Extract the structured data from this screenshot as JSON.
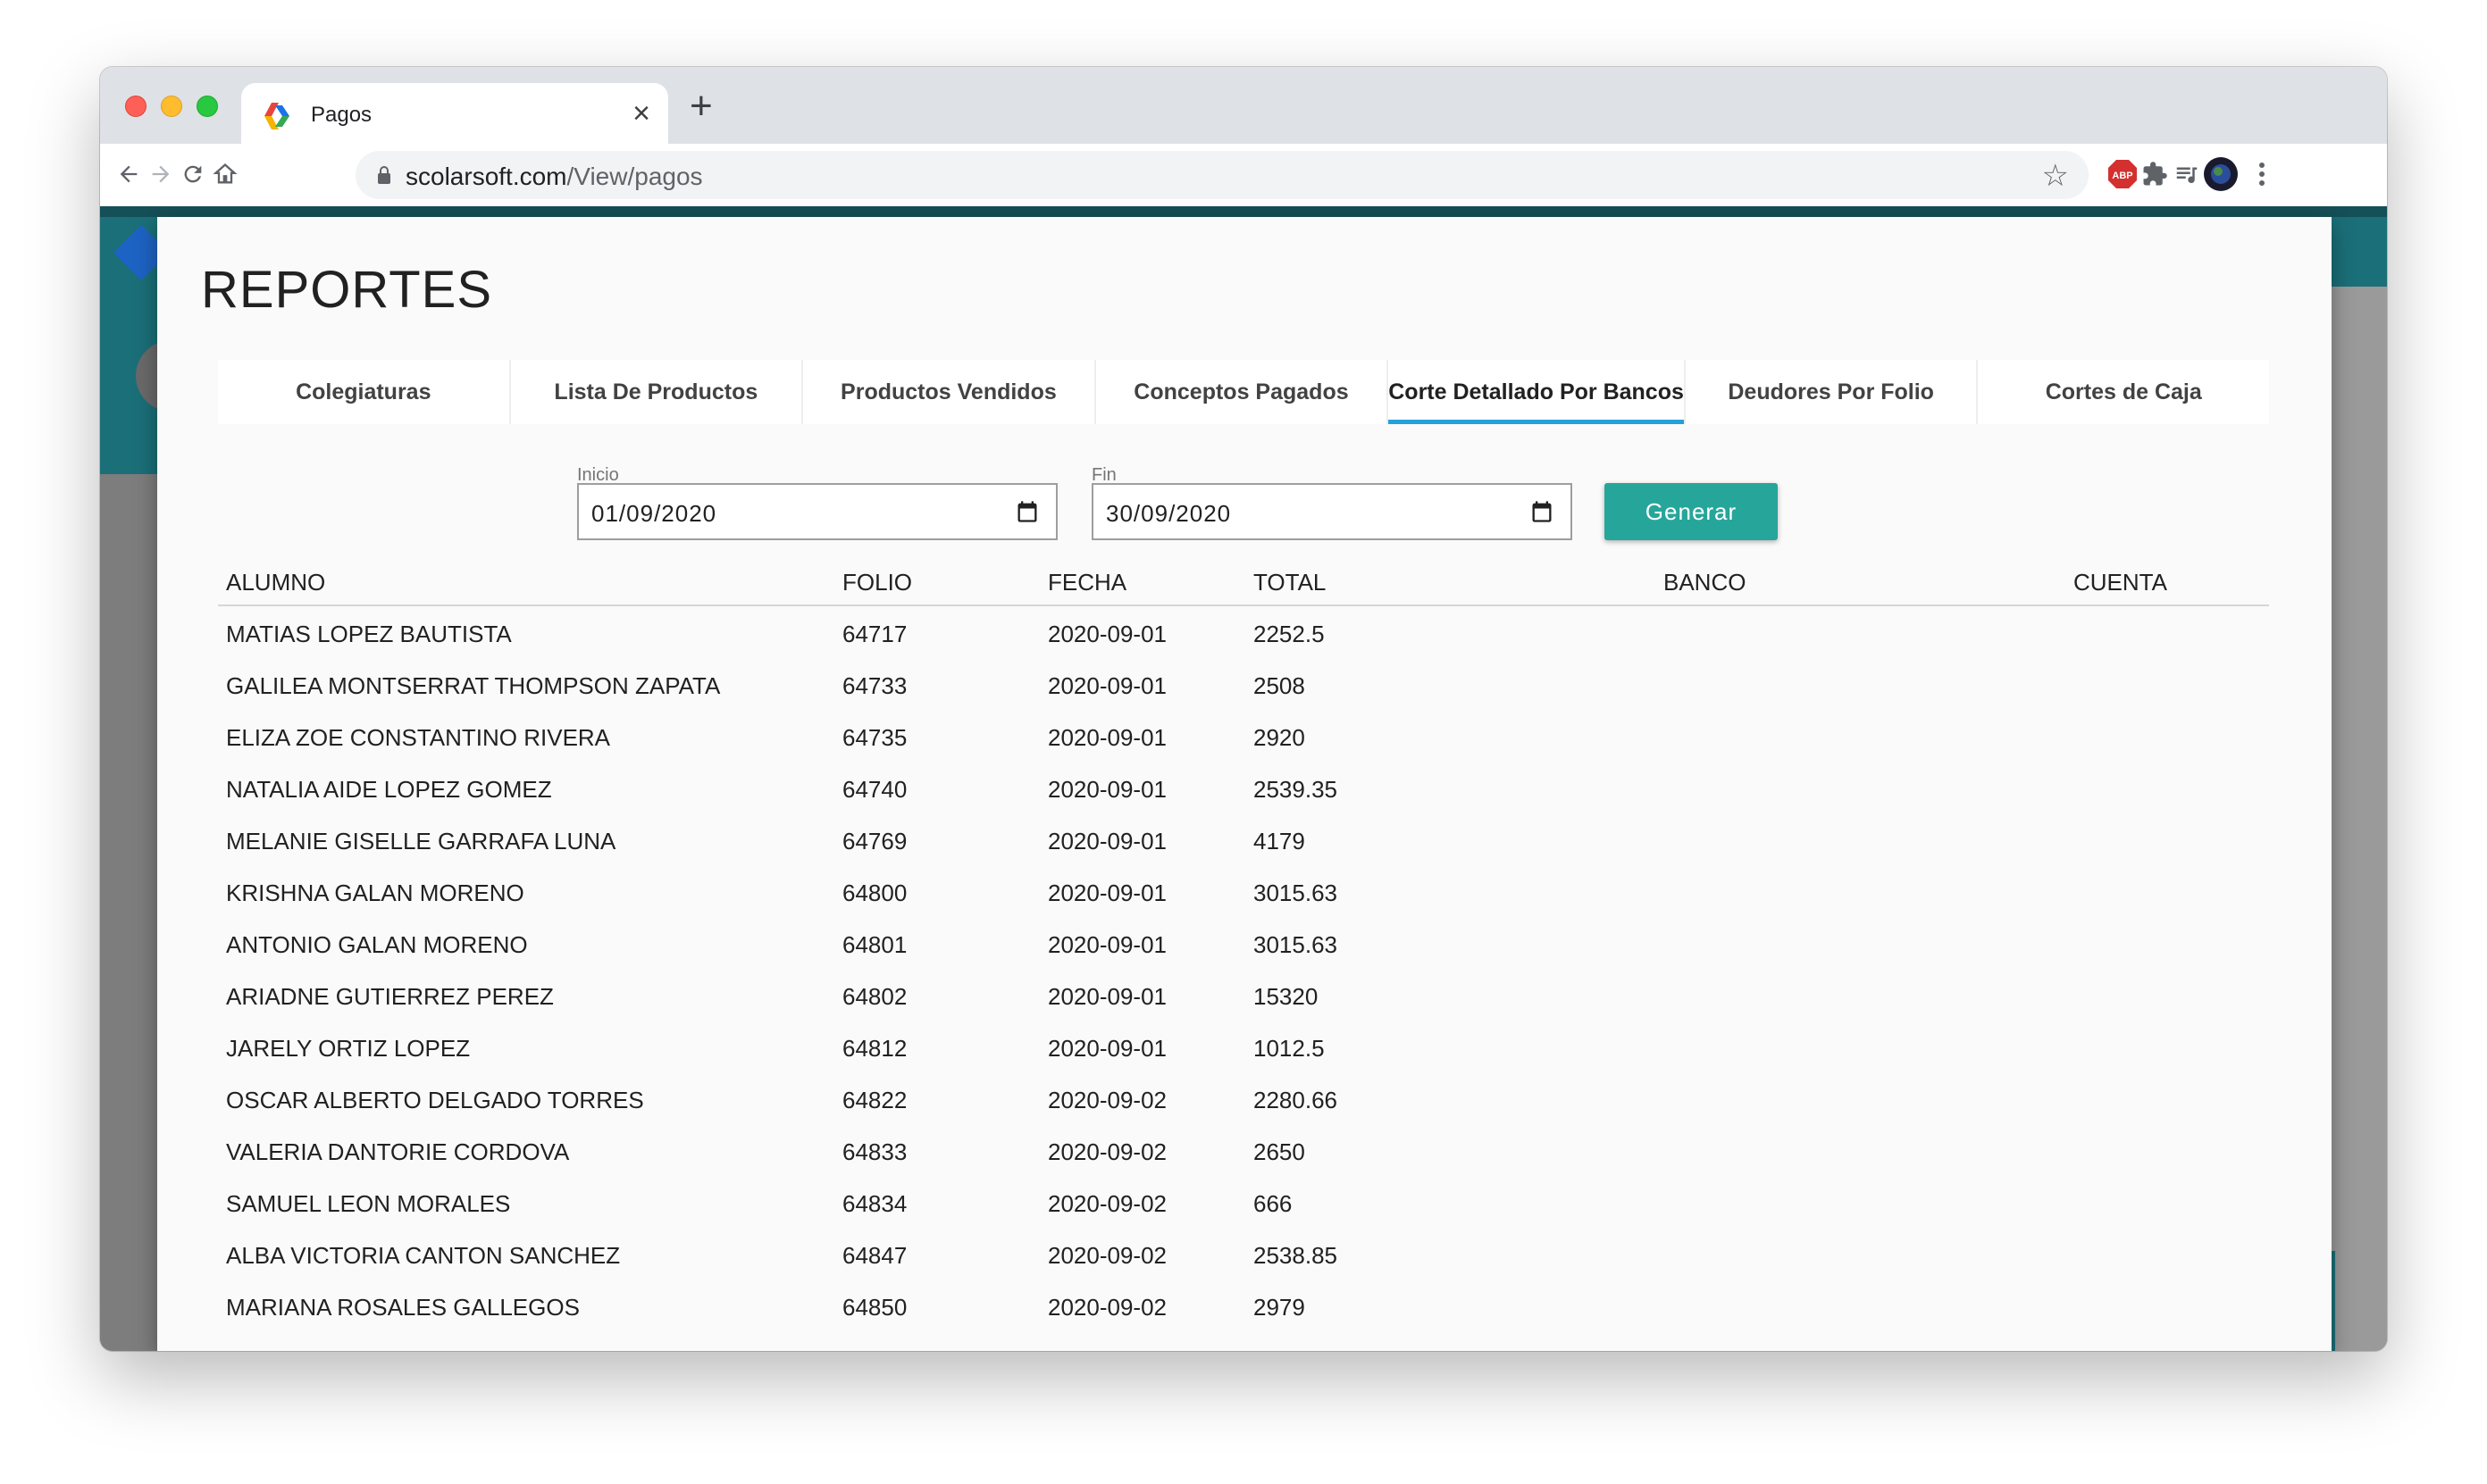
{
  "browser": {
    "tab_title": "Pagos",
    "url_domain": "scolarsoft.com",
    "url_path": "/View/pagos"
  },
  "modal": {
    "title": "REPORTES",
    "tabs": [
      {
        "label": "Colegiaturas"
      },
      {
        "label": "Lista De Productos"
      },
      {
        "label": "Productos Vendidos"
      },
      {
        "label": "Conceptos Pagados"
      },
      {
        "label": "Corte Detallado Por Bancos",
        "active": true
      },
      {
        "label": "Deudores Por Folio"
      },
      {
        "label": "Cortes de Caja"
      }
    ],
    "inicio": {
      "label": "Inicio",
      "value": "01/09/2020"
    },
    "fin": {
      "label": "Fin",
      "value": "30/09/2020"
    },
    "generate_label": "Generar",
    "accent_color": "#26a69a",
    "active_tab_color": "#26a0da"
  },
  "table": {
    "headers": [
      "ALUMNO",
      "FOLIO",
      "FECHA",
      "TOTAL",
      "BANCO",
      "CUENTA"
    ],
    "rows": [
      [
        "MATIAS LOPEZ BAUTISTA",
        "64717",
        "2020-09-01",
        "2252.5",
        "",
        ""
      ],
      [
        "GALILEA MONTSERRAT THOMPSON ZAPATA",
        "64733",
        "2020-09-01",
        "2508",
        "",
        ""
      ],
      [
        "ELIZA ZOE CONSTANTINO RIVERA",
        "64735",
        "2020-09-01",
        "2920",
        "",
        ""
      ],
      [
        "NATALIA AIDE LOPEZ GOMEZ",
        "64740",
        "2020-09-01",
        "2539.35",
        "",
        ""
      ],
      [
        "MELANIE GISELLE GARRAFA LUNA",
        "64769",
        "2020-09-01",
        "4179",
        "",
        ""
      ],
      [
        "KRISHNA GALAN MORENO",
        "64800",
        "2020-09-01",
        "3015.63",
        "",
        ""
      ],
      [
        "ANTONIO GALAN MORENO",
        "64801",
        "2020-09-01",
        "3015.63",
        "",
        ""
      ],
      [
        "ARIADNE GUTIERREZ PEREZ",
        "64802",
        "2020-09-01",
        "15320",
        "",
        ""
      ],
      [
        "JARELY ORTIZ LOPEZ",
        "64812",
        "2020-09-01",
        "1012.5",
        "",
        ""
      ],
      [
        "OSCAR ALBERTO DELGADO TORRES",
        "64822",
        "2020-09-02",
        "2280.66",
        "",
        ""
      ],
      [
        "VALERIA DANTORIE CORDOVA",
        "64833",
        "2020-09-02",
        "2650",
        "",
        ""
      ],
      [
        "SAMUEL LEON MORALES",
        "64834",
        "2020-09-02",
        "666",
        "",
        ""
      ],
      [
        "ALBA VICTORIA CANTON SANCHEZ",
        "64847",
        "2020-09-02",
        "2538.85",
        "",
        ""
      ],
      [
        "MARIANA ROSALES GALLEGOS",
        "64850",
        "2020-09-02",
        "2979",
        "",
        ""
      ]
    ]
  }
}
